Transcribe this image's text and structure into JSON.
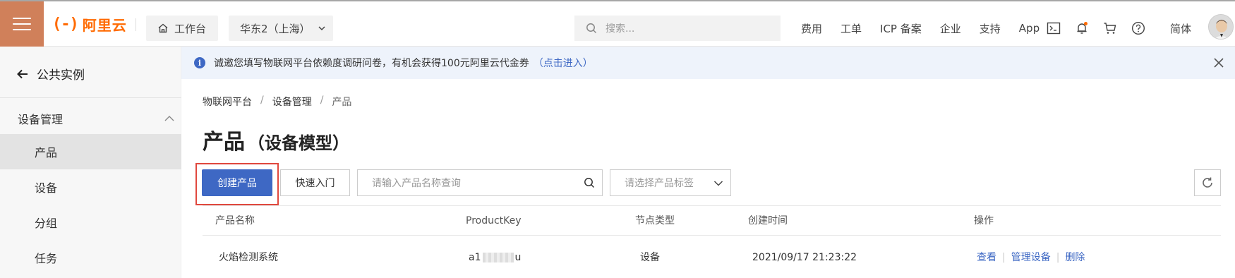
{
  "topbar": {
    "logo_text": "阿里云",
    "logo_mark": "(-)",
    "workbench": "工作台",
    "region": "华东2（上海）",
    "search_placeholder": "搜索...",
    "links": [
      "费用",
      "工单",
      "ICP 备案",
      "企业",
      "支持",
      "App"
    ],
    "icons": [
      "terminal-icon",
      "bell-icon",
      "cart-icon",
      "help-icon"
    ],
    "lang": "简体",
    "notification_dot_color": "#ff6a00"
  },
  "sidebar": {
    "back_label": "公共实例",
    "group_label": "设备管理",
    "items": [
      {
        "label": "产品",
        "active": true
      },
      {
        "label": "设备",
        "active": false
      },
      {
        "label": "分组",
        "active": false
      },
      {
        "label": "任务",
        "active": false
      }
    ]
  },
  "notice": {
    "text": "诚邀您填写物联网平台依赖度调研问卷，有机会获得100元阿里云代金券",
    "link": "（点击进入）"
  },
  "breadcrumb": [
    "物联网平台",
    "设备管理",
    "产品"
  ],
  "page": {
    "title": "产品",
    "subtitle": "（设备模型）"
  },
  "toolbar": {
    "create_label": "创建产品",
    "quickstart_label": "快速入门",
    "search_placeholder": "请输入产品名称查询",
    "tag_placeholder": "请选择产品标签"
  },
  "table": {
    "columns": [
      "产品名称",
      "ProductKey",
      "节点类型",
      "创建时间",
      "操作"
    ],
    "rows": [
      {
        "name": "火焰检测系统",
        "key_prefix": "a1",
        "key_suffix": "u",
        "node_type": "设备",
        "created": "2021/09/17 21:23:22",
        "actions": [
          "查看",
          "管理设备",
          "删除"
        ]
      }
    ]
  },
  "colors": {
    "brand": "#ff6a00",
    "menu_bg": "#d0805a",
    "primary": "#3e68c4",
    "highlight_border": "#e0483e"
  }
}
